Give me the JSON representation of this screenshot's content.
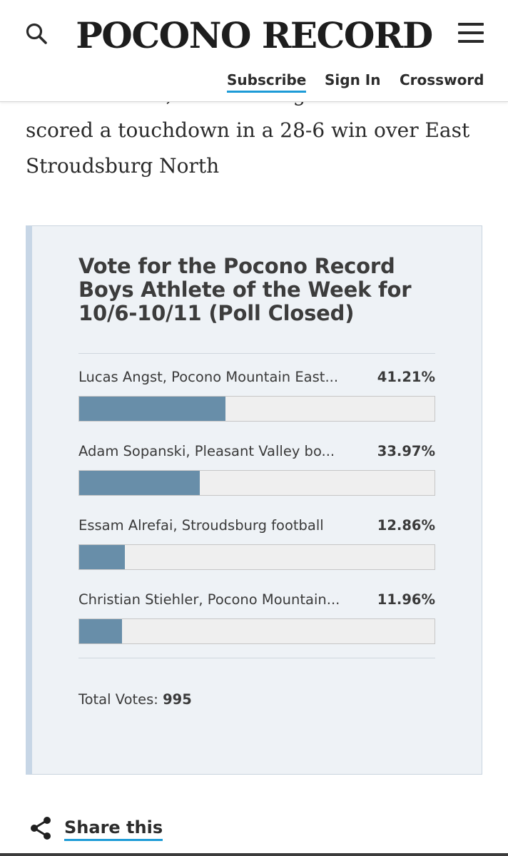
{
  "header": {
    "logo": "POCONO RECORD",
    "search_icon": "search-icon",
    "menu_icon": "hamburger-menu-icon",
    "links": {
      "subscribe": "Subscribe",
      "signin": "Sign In",
      "crossword": "Crossword"
    },
    "accent_color": "#1d9bd7"
  },
  "article": {
    "clipped_line": "Essam Alrefai, Stroudsburg football: He",
    "line2": "scored a touchdown in a 28-6 win over East",
    "line3": "Stroudsburg North"
  },
  "poll": {
    "title": "Vote for the Pocono Record Boys Athlete of the Week for 10/6-10/11 (Poll Closed)",
    "bar_color": "#688ea9",
    "options": [
      {
        "label": "Lucas Angst, Pocono Mountain East...",
        "percent_text": "41.21%",
        "percent": 41.21
      },
      {
        "label": "Adam Sopanski, Pleasant Valley bo...",
        "percent_text": "33.97%",
        "percent": 33.97
      },
      {
        "label": "Essam Alrefai, Stroudsburg football",
        "percent_text": "12.86%",
        "percent": 12.86
      },
      {
        "label": "Christian Stiehler, Pocono Mountain...",
        "percent_text": "11.96%",
        "percent": 11.96
      }
    ],
    "total_label": "Total Votes:",
    "total_value": "995"
  },
  "share": {
    "icon": "share-icon",
    "label": "Share this"
  }
}
